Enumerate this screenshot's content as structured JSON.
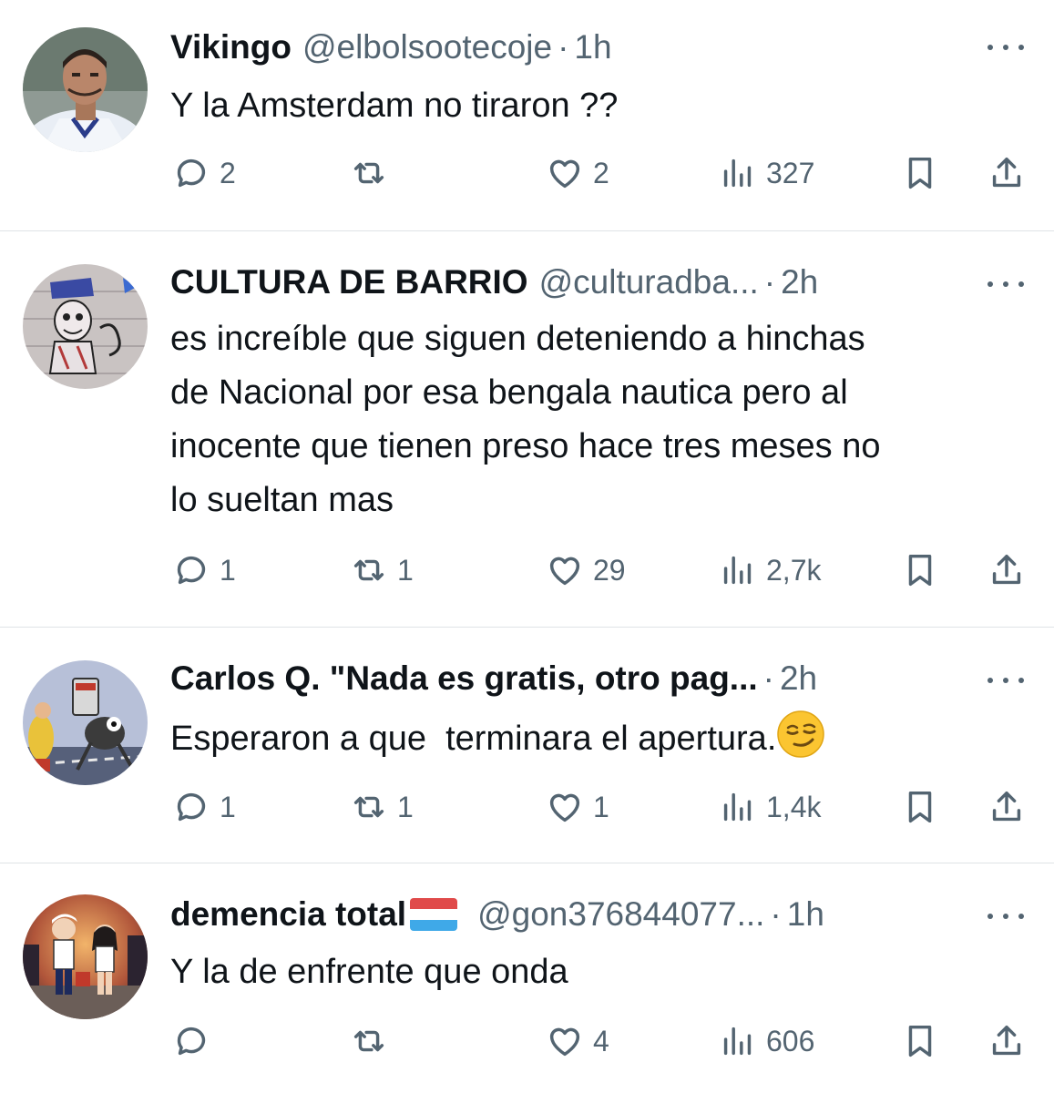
{
  "tweets": [
    {
      "name": "Vikingo",
      "handle": "@elbolsootecoje",
      "separator": "·",
      "time": "1h",
      "lines": [
        "Y la Amsterdam no tiraron ??"
      ],
      "replies": "2",
      "retweets": "",
      "likes": "2",
      "views": "327",
      "avatar": "profile-photo-player"
    },
    {
      "name": "CULTURA DE BARRIO",
      "handle": "@culturadba...",
      "separator": "·",
      "time": "2h",
      "lines": [
        "es increíble que siguen deteniendo a hinchas",
        "de Nacional por esa bengala nautica pero al",
        "inocente que tienen preso hace tres meses no",
        "lo sueltan mas"
      ],
      "replies": "1",
      "retweets": "1",
      "likes": "29",
      "views": "2,7k",
      "avatar": "graffiti-mural"
    },
    {
      "name": "Carlos Q. \"Nada es gratis, otro pag...",
      "handle": "",
      "separator": "·",
      "time": "2h",
      "lines": [
        "Esperaron a que  terminara el apertura."
      ],
      "emoji": "smirking-face-emoji",
      "replies": "1",
      "retweets": "1",
      "likes": "1",
      "views": "1,4k",
      "avatar": "cartoon-illustration"
    },
    {
      "name": "demencia total",
      "flag": "red-white-blue-flag",
      "handle": "@gon376844077...",
      "separator": "·",
      "time": "1h",
      "lines": [
        "Y la de enfrente que onda"
      ],
      "replies": "",
      "retweets": "",
      "likes": "4",
      "views": "606",
      "avatar": "cartoon-couple"
    }
  ],
  "icons": {
    "reply": "reply-icon",
    "retweet": "retweet-icon",
    "like": "heart-icon",
    "views": "views-icon",
    "bookmark": "bookmark-icon",
    "share": "share-icon",
    "more": "more-icon"
  },
  "colors": {
    "text": "#0f1419",
    "secondary": "#536471",
    "divider": "#dfe3e6"
  }
}
